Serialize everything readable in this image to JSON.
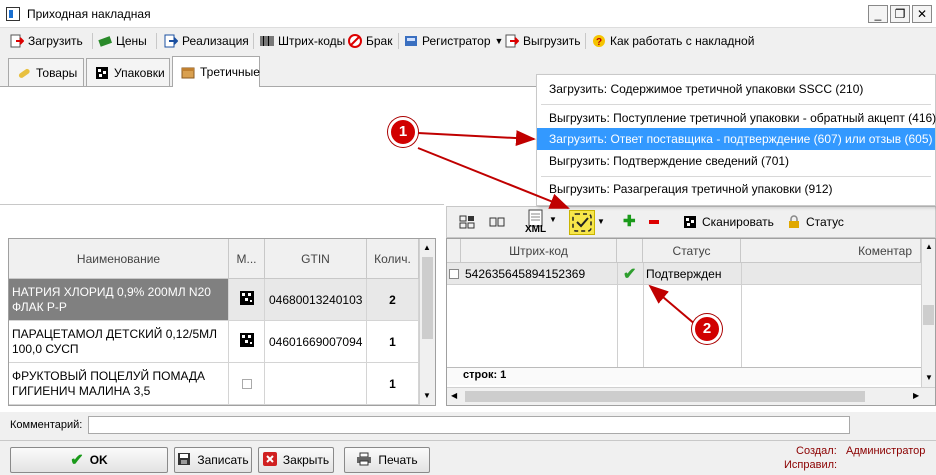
{
  "window": {
    "title": "Приходная накладная"
  },
  "toolbar": {
    "load": "Загрузить",
    "prices": "Цены",
    "sale": "Реализация",
    "barcodes": "Штрих-коды",
    "defect": "Брак",
    "registrator": "Регистратор",
    "unload": "Выгрузить",
    "help": "Как работать с накладной"
  },
  "tabs": [
    "Товары",
    "Упаковки",
    "Третичные"
  ],
  "dropdown": {
    "items": [
      "Загрузить: Содержимое третичной упаковки SSCC (210)",
      "Выгрузить: Поступление третичной упаковки - обратный акцепт (416)",
      "Загрузить: Ответ поставщика - подтверждение (607) или отзыв (605)",
      "Выгрузить: Подтверждение сведений (701)",
      "Выгрузить: Разагрегация третичной упаковки (912)"
    ],
    "highlighted_index": 2
  },
  "right_toolbar": {
    "xml": "XML",
    "scan": "Сканировать",
    "status": "Статус"
  },
  "left_grid": {
    "headers": [
      "Наименование",
      "М...",
      "GTIN",
      "Колич."
    ],
    "rows": [
      {
        "name": "НАТРИЯ ХЛОРИД 0,9% 200МЛ N20 ФЛАК Р-Р",
        "gtin": "04680013240103",
        "qty": "2"
      },
      {
        "name": "ПАРАЦЕТАМОЛ ДЕТСКИЙ 0,12/5МЛ 100,0 СУСП",
        "gtin": "04601669007094",
        "qty": "1"
      },
      {
        "name": "ФРУКТОВЫЙ ПОЦЕЛУЙ ПОМАДА ГИГИЕНИЧ МАЛИНА 3,5",
        "gtin": "",
        "qty": "1"
      }
    ]
  },
  "right_grid": {
    "headers": [
      "Штрих-код",
      "Статус",
      "Коментар"
    ],
    "rows": [
      {
        "barcode": "542635645894152369",
        "status": "Подтвержден"
      }
    ],
    "footer": "строк: 1"
  },
  "comment": {
    "label": "Комментарий:",
    "value": ""
  },
  "bottom": {
    "ok": "OK",
    "save": "Записать",
    "close": "Закрыть",
    "print": "Печать",
    "created_label": "Создал:",
    "created_value": "Администратор",
    "edited_label": "Исправил:",
    "edited_value": ""
  },
  "annotations": [
    "1",
    "2"
  ],
  "colors": {
    "highlight": "#3399ff",
    "badge": "#d10000",
    "arrow": "#c00000",
    "selected_row": "#808080",
    "check": "#2e9e2e"
  }
}
